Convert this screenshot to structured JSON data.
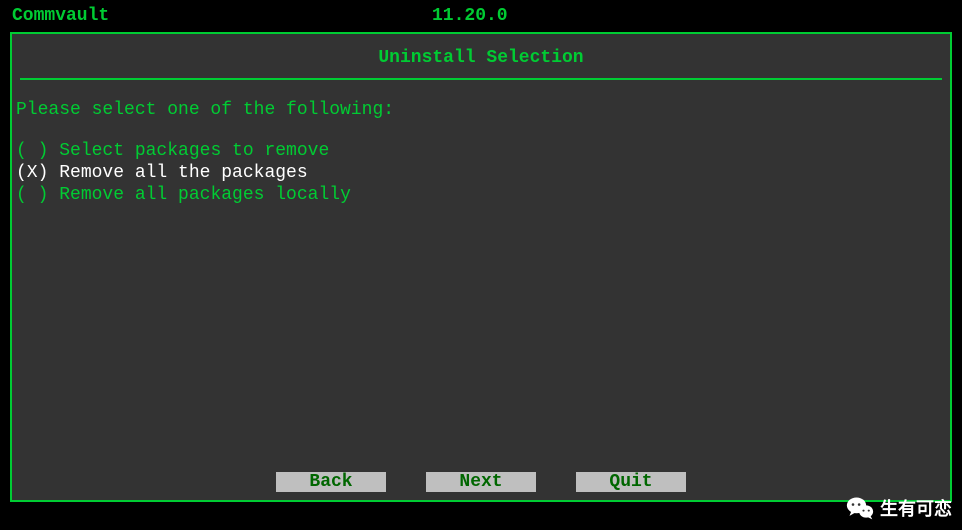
{
  "header": {
    "app_name": "Commvault",
    "version": "11.20.0"
  },
  "dialog": {
    "title": "Uninstall Selection",
    "prompt": "Please select one of the following:",
    "options": [
      {
        "label": "Select packages to remove",
        "selected": false
      },
      {
        "label": "Remove all the packages",
        "selected": true
      },
      {
        "label": "Remove all packages locally",
        "selected": false
      }
    ],
    "buttons": {
      "back": "Back",
      "next": "Next",
      "quit": "Quit"
    }
  },
  "watermark": {
    "text": "生有可恋"
  }
}
